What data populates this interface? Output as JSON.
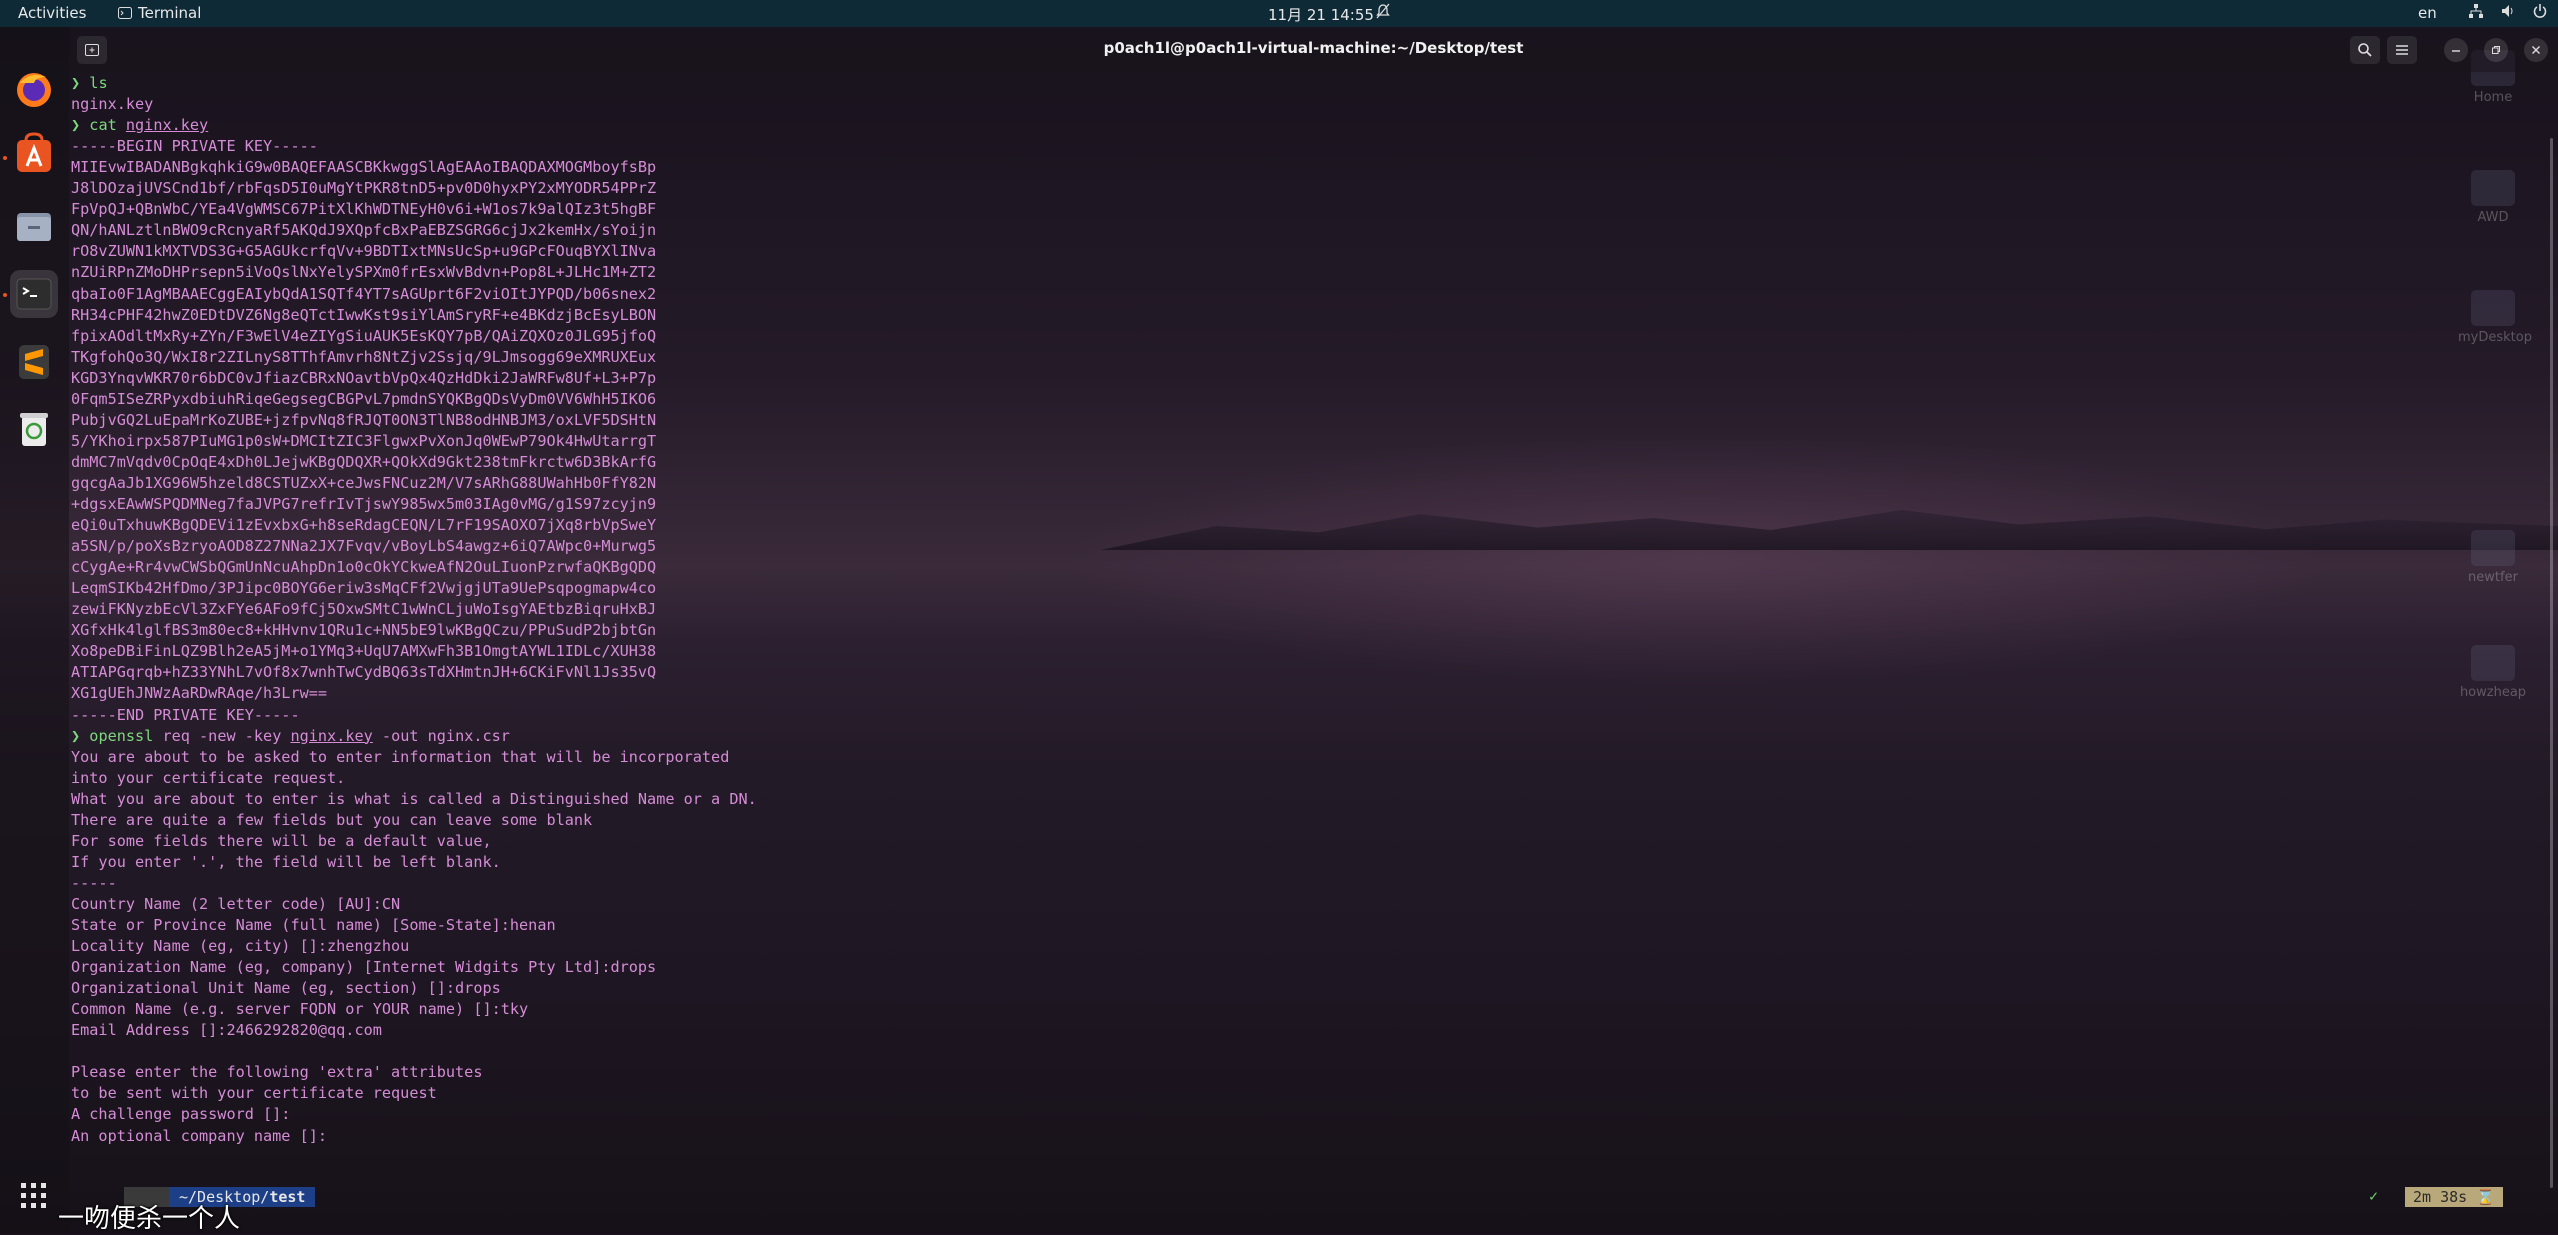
{
  "topbar": {
    "activities": "Activities",
    "app_name": "Terminal",
    "clock": "11月 21  14:55",
    "lang": "en"
  },
  "window": {
    "title": "p0ach1l@p0ach1l-virtual-machine:~/Desktop/test"
  },
  "terminal": {
    "lines": [
      {
        "type": "prompt",
        "cmd": "ls",
        "arg": ""
      },
      {
        "type": "text",
        "text": "nginx.key"
      },
      {
        "type": "prompt",
        "cmd": "cat",
        "arg": "nginx.key"
      },
      {
        "type": "text",
        "text": "-----BEGIN PRIVATE KEY-----"
      },
      {
        "type": "text",
        "text": "MIIEvwIBADANBgkqhkiG9w0BAQEFAASCBKkwggSlAgEAAoIBAQDAXMOGMboyfsBp"
      },
      {
        "type": "text",
        "text": "J8lDOzajUVSCnd1bf/rbFqsD5I0uMgYtPKR8tnD5+pv0D0hyxPY2xMYODR54PPrZ"
      },
      {
        "type": "text",
        "text": "FpVpQJ+QBnWbC/YEa4VgWMSC67PitXlKhWDTNEyH0v6i+W1os7k9alQIz3t5hgBF"
      },
      {
        "type": "text",
        "text": "QN/hANLztlnBWO9cRcnyaRf5AKQdJ9XQpfcBxPaEBZSGRG6cjJx2kemHx/sYoijn"
      },
      {
        "type": "text",
        "text": "rO8vZUWN1kMXTVDS3G+G5AGUkcrfqVv+9BDTIxtMNsUcSp+u9GPcFOuqBYXlINva"
      },
      {
        "type": "text",
        "text": "nZUiRPnZMoDHPrsepn5iVoQslNxYelySPXm0frEsxWvBdvn+Pop8L+JLHc1M+ZT2"
      },
      {
        "type": "text",
        "text": "qbaIo0F1AgMBAAECggEAIybQdA1SQTf4YT7sAGUprt6F2viOItJYPQD/b06snex2"
      },
      {
        "type": "text",
        "text": "RH34cPHF42hwZ0EDtDVZ6Ng8eQTctIwwKst9siYlAmSryRF+e4BKdzjBcEsyLBON"
      },
      {
        "type": "text",
        "text": "fpixAOdltMxRy+ZYn/F3wElV4eZIYgSiuAUK5EsKQY7pB/QAiZQXOz0JLG95jfoQ"
      },
      {
        "type": "text",
        "text": "TKgfohQo3Q/WxI8r2ZILnyS8TThfAmvrh8NtZjv2Ssjq/9LJmsogg69eXMRUXEux"
      },
      {
        "type": "text",
        "text": "KGD3YnqvWKR70r6bDC0vJfiazCBRxNOavtbVpQx4QzHdDki2JaWRFw8Uf+L3+P7p"
      },
      {
        "type": "text",
        "text": "0Fqm5ISeZRPyxdbiuhRiqeGegsegCBGPvL7pmdnSYQKBgQDsVyDm0VV6WhH5IKO6"
      },
      {
        "type": "text",
        "text": "PubjvGQ2LuEpaMrKoZUBE+jzfpvNq8fRJQT0ON3TlNB8odHNBJM3/oxLVF5DSHtN"
      },
      {
        "type": "text",
        "text": "5/YKhoirpx587PIuMG1p0sW+DMCItZIC3FlgwxPvXonJq0WEwP79Ok4HwUtarrgT"
      },
      {
        "type": "text",
        "text": "dmMC7mVqdv0CpOqE4xDh0LJejwKBgQDQXR+QOkXd9Gkt238tmFkrctw6D3BkArfG"
      },
      {
        "type": "text",
        "text": "gqcgAaJb1XG96W5hzeld8CSTUZxX+ceJwsFNCuz2M/V7sARhG88UWahHb0FfY82N"
      },
      {
        "type": "text",
        "text": "+dgsxEAwWSPQDMNeg7faJVPG7refrIvTjswY985wx5m03IAg0vMG/g1S97zcyjn9"
      },
      {
        "type": "text",
        "text": "eQi0uTxhuwKBgQDEVi1zEvxbxG+h8seRdagCEQN/L7rF19SAOXO7jXq8rbVpSweY"
      },
      {
        "type": "text",
        "text": "a5SN/p/poXsBzryoAOD8Z27NNa2JX7Fvqv/vBoyLbS4awgz+6iQ7AWpc0+Murwg5"
      },
      {
        "type": "text",
        "text": "cCygAe+Rr4vwCWSbQGmUnNcuAhpDn1o0cOkYCkweAfN2OuLIuonPzrwfaQKBgQDQ"
      },
      {
        "type": "text",
        "text": "LeqmSIKb42HfDmo/3PJipc0BOYG6eriw3sMqCFf2VwjgjUTa9UePsqpogmapw4co"
      },
      {
        "type": "text",
        "text": "zewiFKNyzbEcVl3ZxFYe6AFo9fCj5OxwSMtC1wWnCLjuWoIsgYAEtbzBiqruHxBJ"
      },
      {
        "type": "text",
        "text": "XGfxHk4lglfBS3m80ec8+kHHvnv1QRu1c+NN5bE9lwKBgQCzu/PPuSudP2bjbtGn"
      },
      {
        "type": "text",
        "text": "Xo8peDBiFinLQZ9Blh2eA5jM+o1YMq3+UqU7AMXwFh3B1OmgtAYWL1IDLc/XUH38"
      },
      {
        "type": "text",
        "text": "ATIAPGqrqb+hZ33YNhL7vOf8x7wnhTwCydBQ63sTdXHmtnJH+6CKiFvNl1Js35vQ"
      },
      {
        "type": "text",
        "text": "XG1gUEhJNWzAaRDwRAqe/h3Lrw=="
      },
      {
        "type": "text",
        "text": "-----END PRIVATE KEY-----"
      },
      {
        "type": "prompt",
        "cmd": "openssl",
        "arg": "req -new -key ",
        "arg_u": "nginx.key",
        "arg_tail": " -out nginx.csr"
      },
      {
        "type": "text",
        "text": "You are about to be asked to enter information that will be incorporated"
      },
      {
        "type": "text",
        "text": "into your certificate request."
      },
      {
        "type": "text",
        "text": "What you are about to enter is what is called a Distinguished Name or a DN."
      },
      {
        "type": "text",
        "text": "There are quite a few fields but you can leave some blank"
      },
      {
        "type": "text",
        "text": "For some fields there will be a default value,"
      },
      {
        "type": "text",
        "text": "If you enter '.', the field will be left blank."
      },
      {
        "type": "text",
        "text": "-----"
      },
      {
        "type": "text",
        "text": "Country Name (2 letter code) [AU]:CN"
      },
      {
        "type": "text",
        "text": "State or Province Name (full name) [Some-State]:henan"
      },
      {
        "type": "text",
        "text": "Locality Name (eg, city) []:zhengzhou"
      },
      {
        "type": "text",
        "text": "Organization Name (eg, company) [Internet Widgits Pty Ltd]:drops"
      },
      {
        "type": "text",
        "text": "Organizational Unit Name (eg, section) []:drops"
      },
      {
        "type": "text",
        "text": "Common Name (e.g. server FQDN or YOUR name) []:tky"
      },
      {
        "type": "text",
        "text": "Email Address []:2466292820@qq.com"
      },
      {
        "type": "text",
        "text": ""
      },
      {
        "type": "text",
        "text": "Please enter the following 'extra' attributes"
      },
      {
        "type": "text",
        "text": "to be sent with your certificate request"
      },
      {
        "type": "text",
        "text": "A challenge password []:"
      },
      {
        "type": "text",
        "text": "An optional company name []:"
      }
    ],
    "prompt_symbol": "❯"
  },
  "statusbar": {
    "dir_prefix": "~/Desktop/",
    "dir_bold": "test",
    "check": "✓",
    "elapsed": "2m 38s",
    "hourglass": "⌛"
  },
  "desktop_icons": [
    "Home",
    "AWD",
    "myDesktop",
    "newtfer",
    "howzheap"
  ],
  "subtitle": "一吻便杀一个人",
  "colors": {
    "topbar": "#0e2a37",
    "prompt_green": "#7dd87d",
    "text_magenta": "#d58cd6",
    "dir_segment": "#1c3f87",
    "time_segment": "#b9a97a"
  }
}
